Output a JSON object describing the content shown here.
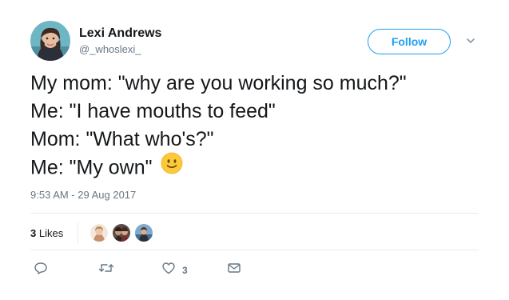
{
  "user": {
    "display_name": "Lexi Andrews",
    "handle": "@_whoslexi_"
  },
  "header": {
    "follow_label": "Follow"
  },
  "tweet": {
    "lines": [
      "My mom: \"why are you working so much?\"",
      "Me: \"I have mouths to feed\"",
      "Mom: \"What who's?\"",
      "Me: \"My own\""
    ],
    "emoji": "slightly-smiling-face",
    "timestamp": "9:53 AM - 29 Aug 2017"
  },
  "stats": {
    "likes_count": "3",
    "likes_label": "Likes"
  },
  "actions": {
    "reply_icon": "reply-icon",
    "retweet_icon": "retweet-icon",
    "like_icon": "heart-icon",
    "like_count": "3",
    "dm_icon": "direct-message-icon"
  },
  "colors": {
    "accent": "#1da1f2",
    "text": "#14171a",
    "muted": "#657786",
    "divider": "#e6ecf0"
  }
}
